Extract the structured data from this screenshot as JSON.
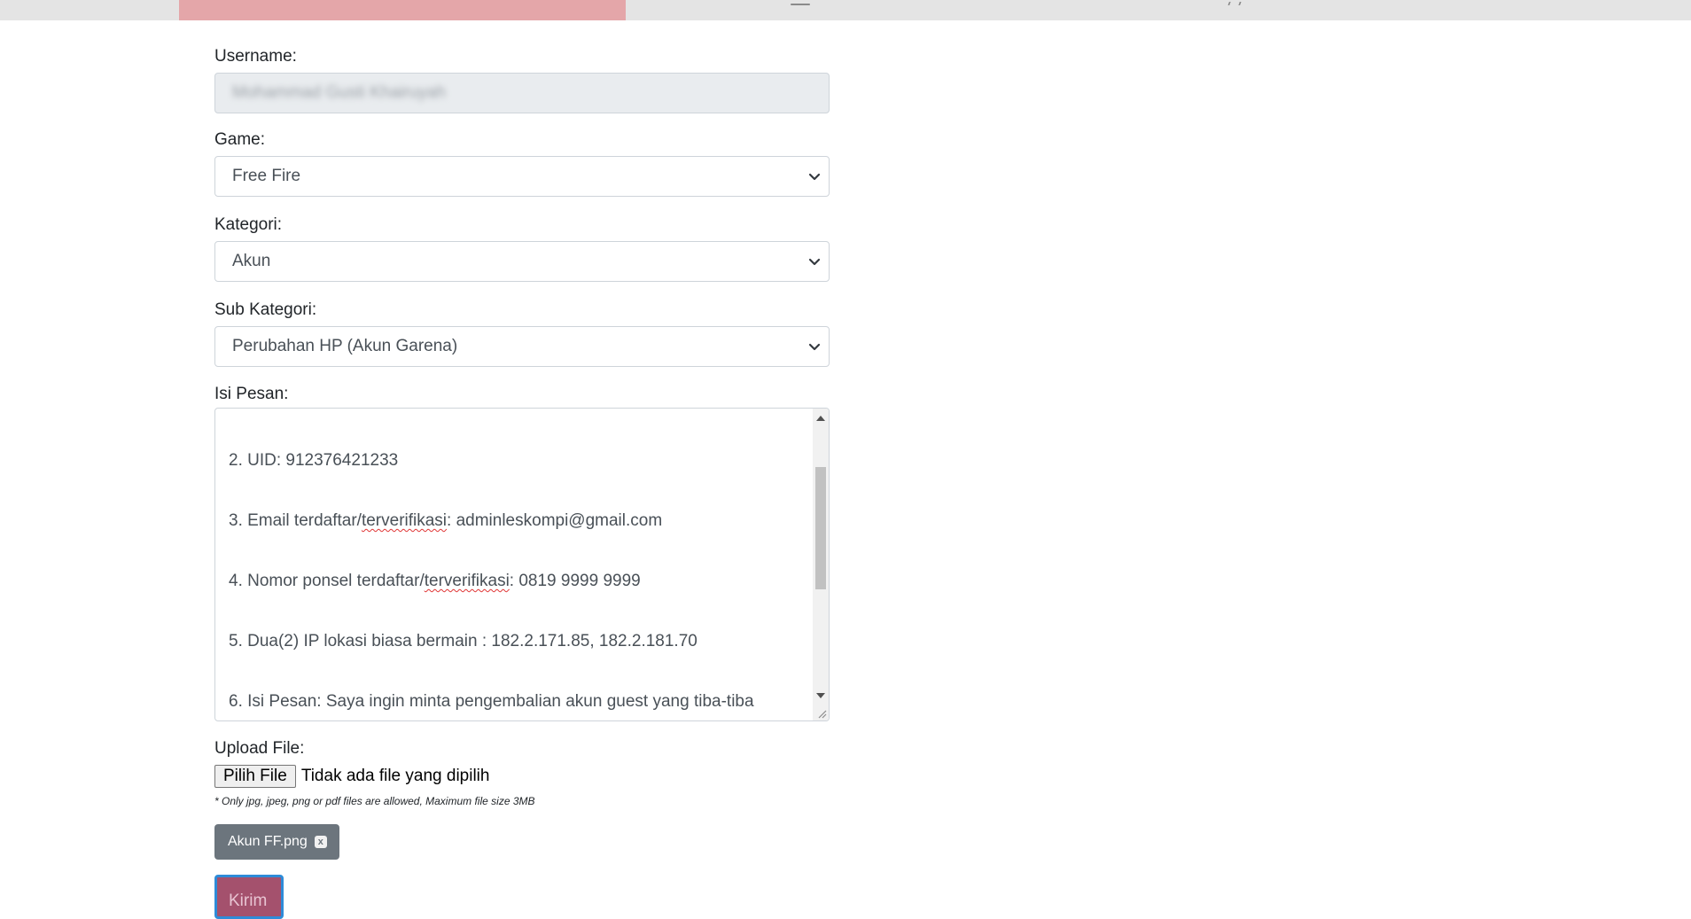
{
  "form": {
    "username_label": "Username:",
    "username_value": "Mohammad Gusti Khairuyah",
    "game_label": "Game:",
    "game_value": "Free Fire",
    "kategori_label": "Kategori:",
    "kategori_value": "Akun",
    "subkategori_label": "Sub Kategori:",
    "subkategori_value": "Perubahan HP (Akun Garena)",
    "pesan_label": "Isi Pesan:",
    "pesan_lines": {
      "uid": "2. UID:  912376421233",
      "email_prefix": "3. Email terdaftar/",
      "email_misspelled": "terverifikasi",
      "email_suffix": ":  adminleskompi@gmail.com",
      "phone_prefix": "4. Nomor ponsel terdaftar/",
      "phone_misspelled": "terverifikasi",
      "phone_suffix": ":   0819 9999 9999",
      "ip": "5. Dua(2) IP lokasi biasa bermain : 182.2.171.85, 182.2.181.70",
      "message": "6. Isi Pesan: Saya ingin minta pengembalian akun guest yang tiba-tiba"
    },
    "upload_label": "Upload File:",
    "file_button_label": "Pilih File",
    "file_status": "Tidak ada file yang dipilih",
    "file_hint": "* Only jpg, jpeg, png or pdf files are allowed, Maximum file size 3MB",
    "attached_file": "Akun FF.png",
    "remove_glyph": "x",
    "submit_label": "Kirim"
  },
  "colors": {
    "active_tab": "#e4a6a9",
    "chip_bg": "#6c757d",
    "submit_bg": "#a4516d",
    "submit_border": "#2e8bd8"
  }
}
